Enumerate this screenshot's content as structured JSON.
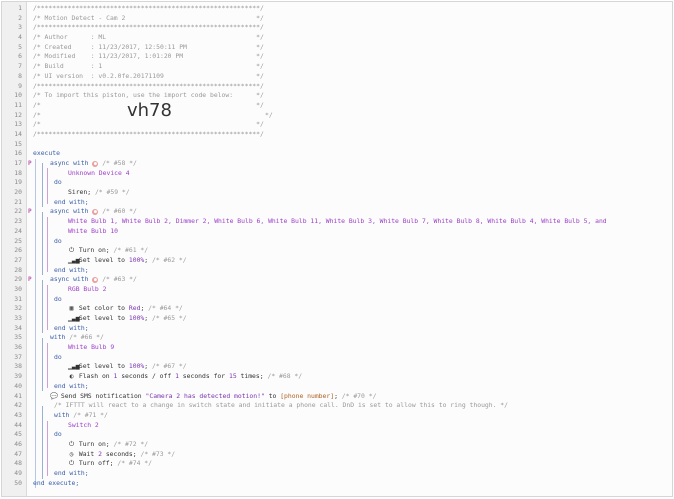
{
  "editor": {
    "lines": [
      {
        "n": "1",
        "t": "/**********************************************************/"
      },
      {
        "n": "2",
        "t": "/* Motion Detect - Cam 2                                  */"
      },
      {
        "n": "3",
        "t": "/**********************************************************/"
      },
      {
        "n": "4",
        "t": "/* Author      : ML                                       */"
      },
      {
        "n": "5",
        "t": "/* Created     : 11/23/2017, 12:50:11 PM                  */"
      },
      {
        "n": "6",
        "t": "/* Modified    : 11/23/2017, 1:01:20 PM                   */"
      },
      {
        "n": "7",
        "t": "/* Build       : 1                                        */"
      },
      {
        "n": "8",
        "t": "/* UI version  : v0.2.0fe.20171109                        */"
      },
      {
        "n": "9",
        "t": "/**********************************************************/"
      },
      {
        "n": "10",
        "t": "/* To import this piston, use the import code below:      */"
      },
      {
        "n": "11",
        "t": "/*                                                        */"
      },
      {
        "n": "12",
        "t": "/*"
      },
      {
        "n": "13",
        "t": "/*                                                        */"
      },
      {
        "n": "14",
        "t": "/**********************************************************/"
      },
      {
        "n": "15",
        "t": ""
      },
      {
        "n": "16",
        "t": "execute"
      },
      {
        "n": "17",
        "t": "async with"
      },
      {
        "n": "18",
        "t": "Unknown Device 4"
      },
      {
        "n": "19",
        "t": "do"
      },
      {
        "n": "20",
        "t": "Siren;"
      },
      {
        "n": "21",
        "t": "end with;"
      },
      {
        "n": "22",
        "t": "async with"
      },
      {
        "n": "23",
        "t": "White Bulb 1, White Bulb 2, Dimmer 2, White Bulb 6, White Bulb 11, White Bulb 3, White Bulb 7, White Bulb 8, White Bulb 4, White Bulb 5, and"
      },
      {
        "n": "24",
        "t": "White Bulb 10"
      },
      {
        "n": "25",
        "t": "do"
      },
      {
        "n": "26",
        "t": "Turn on;"
      },
      {
        "n": "27",
        "t": "Set level to"
      },
      {
        "n": "28",
        "t": "end with;"
      },
      {
        "n": "29",
        "t": "async with"
      },
      {
        "n": "30",
        "t": "RGB Bulb 2"
      },
      {
        "n": "31",
        "t": "do"
      },
      {
        "n": "32",
        "t": "Set color to"
      },
      {
        "n": "33",
        "t": "Set level to"
      },
      {
        "n": "34",
        "t": "end with;"
      },
      {
        "n": "35",
        "t": "with"
      },
      {
        "n": "36",
        "t": "White Bulb 9"
      },
      {
        "n": "37",
        "t": "do"
      },
      {
        "n": "38",
        "t": "Set level to"
      },
      {
        "n": "39",
        "t": "Flash on"
      },
      {
        "n": "40",
        "t": "end with;"
      },
      {
        "n": "41",
        "t": "Send SMS notification"
      },
      {
        "n": "42",
        "t": "/* IFTTT will react to a change in switch state and initiate a phone call. DnD is set to allow this to ring though. */"
      },
      {
        "n": "43",
        "t": "with"
      },
      {
        "n": "44",
        "t": "Switch 2"
      },
      {
        "n": "45",
        "t": "do"
      },
      {
        "n": "46",
        "t": "Turn on;"
      },
      {
        "n": "47",
        "t": "Wait"
      },
      {
        "n": "48",
        "t": "Turn off;"
      },
      {
        "n": "49",
        "t": "end with;"
      },
      {
        "n": "50",
        "t": "end execute;"
      }
    ],
    "import_code": "vh78",
    "import_code_suffix": "*/",
    "comments": {
      "c58": "/* #58 */",
      "c59": "/* #59 */",
      "c60": "/* #60 */",
      "c61": "/* #61 */",
      "c62": "/* #62 */",
      "c63": "/* #63 */",
      "c64": "/* #64 */",
      "c65": "/* #65 */",
      "c66": "/* #66 */",
      "c67": "/* #67 */",
      "c68": "/* #68 */",
      "c70": "/* #70 */",
      "c71": "/* #71 */",
      "c72": "/* #72 */",
      "c73": "/* #73 */",
      "c74": "/* #74 */"
    },
    "values": {
      "level": "100%",
      "color": "Red",
      "flash_on": "1",
      "flash_mid": " seconds / off ",
      "flash_off": "1",
      "flash_for": " seconds for ",
      "flash_times": "15",
      "flash_end": " times;",
      "sms_message": "\"Camera 2 has detected motion!\"",
      "sms_to": " to ",
      "sms_recipient": "[phone number]",
      "wait_value": "2",
      "wait_unit": " seconds;",
      "semicolon": ";"
    },
    "markers": {
      "p": "P"
    }
  }
}
